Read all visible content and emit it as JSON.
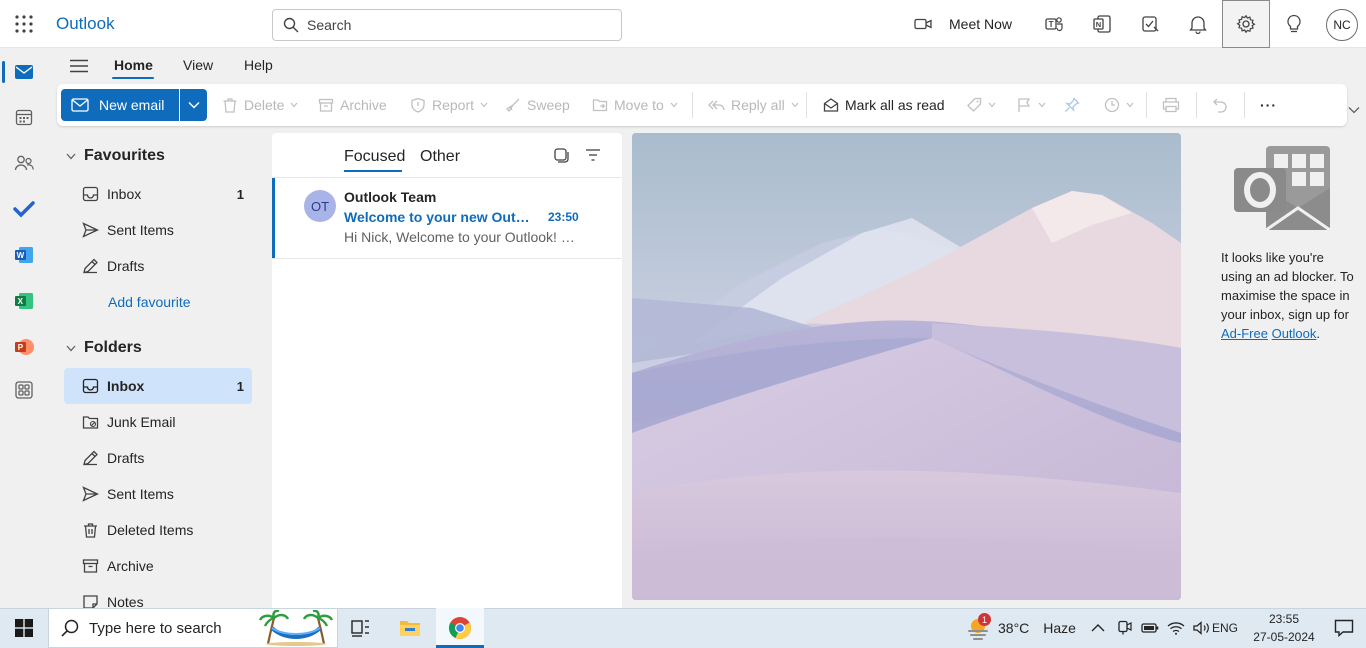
{
  "app": {
    "brand": "Outlook"
  },
  "search": {
    "placeholder": "Search"
  },
  "topbar": {
    "meet_now": "Meet Now",
    "profile_initials": "NC",
    "icons": [
      "waffle-icon",
      "video-camera-icon",
      "teams-icon",
      "onenote-icon",
      "my-day-icon",
      "bell-icon",
      "gear-icon",
      "lightbulb-icon"
    ]
  },
  "tabs": {
    "home": "Home",
    "view": "View",
    "help": "Help"
  },
  "ribbon": {
    "new_email": "New email",
    "delete": "Delete",
    "archive": "Archive",
    "report": "Report",
    "sweep": "Sweep",
    "move_to": "Move to",
    "reply_all": "Reply all",
    "mark_all_read": "Mark all as read",
    "more": "···"
  },
  "favourites": {
    "header": "Favourites",
    "items": [
      {
        "label": "Inbox",
        "count": "1"
      },
      {
        "label": "Sent Items",
        "count": ""
      },
      {
        "label": "Drafts",
        "count": ""
      }
    ],
    "add": "Add favourite"
  },
  "folders": {
    "header": "Folders",
    "items": [
      {
        "label": "Inbox",
        "count": "1"
      },
      {
        "label": "Junk Email",
        "count": ""
      },
      {
        "label": "Drafts",
        "count": ""
      },
      {
        "label": "Sent Items",
        "count": ""
      },
      {
        "label": "Deleted Items",
        "count": ""
      },
      {
        "label": "Archive",
        "count": ""
      },
      {
        "label": "Notes",
        "count": ""
      }
    ]
  },
  "message_list": {
    "pivot_focused": "Focused",
    "pivot_other": "Other",
    "messages": [
      {
        "initials": "OT",
        "sender": "Outlook Team",
        "subject": "Welcome to your new Outlook.com account",
        "time": "23:50",
        "preview": "Hi Nick, Welcome to your Outlook! We're excited"
      }
    ]
  },
  "ad_panel": {
    "text": "It looks like you're using an ad blocker. To maximise the space in your inbox, sign up for ",
    "link1": "Ad-Free",
    "link2": "Outlook",
    "end": "."
  },
  "taskbar": {
    "search_placeholder": "Type here to search",
    "weather_temp": "38°C",
    "weather_desc": "Haze",
    "weather_badge": "1",
    "language": "ENG",
    "time": "23:55",
    "date": "27-05-2024"
  },
  "colors": {
    "accent": "#0f6cbd",
    "selected": "#cfe4fa",
    "unread": "#0f6cbd"
  }
}
